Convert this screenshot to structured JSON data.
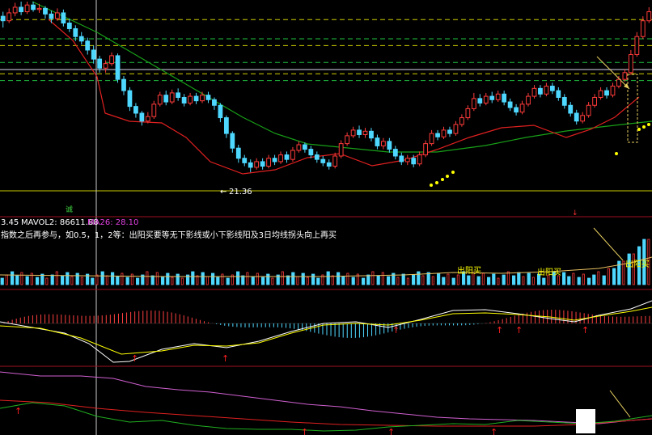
{
  "colors": {
    "up": "#ff3b3b",
    "down": "#4fd8ff",
    "ma_fast": "#e02020",
    "ma_slow": "#18a018",
    "yellow": "#ffff00",
    "white": "#ffffff",
    "magenta": "#e040e0",
    "frame": "#a01020"
  },
  "labels": {
    "low_price": "21.36",
    "vol_prefix": "3.45",
    "mavol2": "MAVOL2: 86611.88",
    "ma26": "MA26: 28.10",
    "note": "指数之后再参与，如0.5，1，2等：出阳买要等无下影线或小下影线阳及3日均线拐头向上再买",
    "buy_1": "出阳买",
    "buy_2": "出阳买",
    "buy_3": "出阳买",
    "marker_cheng": "诚"
  },
  "chart_data": {
    "type": "candlestick",
    "price": {
      "ylim": [
        20,
        36.5
      ],
      "levels": [
        34.9,
        33.2,
        32.6,
        31.1,
        30.1,
        29.5
      ],
      "candles": [
        [
          35.2,
          34.8,
          35.6,
          34.2
        ],
        [
          34.8,
          35.5,
          35.9,
          34.6
        ],
        [
          35.5,
          36.0,
          36.4,
          35.2
        ],
        [
          36.0,
          35.6,
          36.5,
          35.3
        ],
        [
          35.6,
          36.2,
          36.5,
          35.4
        ],
        [
          36.2,
          35.8,
          36.5,
          35.6
        ],
        [
          35.8,
          35.9,
          36.3,
          35.5
        ],
        [
          35.9,
          35.4,
          36.1,
          35.0
        ],
        [
          35.4,
          35.0,
          35.7,
          34.6
        ],
        [
          35.0,
          35.5,
          35.9,
          34.8
        ],
        [
          35.5,
          34.6,
          35.8,
          34.3
        ],
        [
          34.6,
          34.1,
          35.0,
          33.8
        ],
        [
          34.1,
          33.4,
          34.4,
          33.0
        ],
        [
          33.4,
          33.0,
          33.8,
          32.7
        ],
        [
          33.0,
          32.2,
          33.3,
          31.8
        ],
        [
          32.2,
          31.4,
          32.6,
          31.0
        ],
        [
          31.4,
          30.6,
          31.7,
          30.2
        ],
        [
          30.6,
          31.0,
          31.3,
          30.2
        ],
        [
          31.0,
          31.7,
          32.0,
          30.8
        ],
        [
          31.7,
          29.6,
          31.9,
          29.3
        ],
        [
          29.6,
          28.6,
          29.9,
          28.2
        ],
        [
          28.6,
          27.2,
          28.9,
          26.8
        ],
        [
          27.2,
          26.6,
          27.5,
          26.2
        ],
        [
          26.6,
          25.9,
          26.8,
          25.5
        ],
        [
          25.9,
          26.3,
          26.7,
          25.7
        ],
        [
          26.3,
          27.4,
          27.7,
          26.1
        ],
        [
          27.4,
          28.2,
          28.5,
          27.2
        ],
        [
          28.2,
          27.6,
          28.6,
          27.3
        ],
        [
          27.6,
          28.4,
          28.7,
          27.4
        ],
        [
          28.4,
          28.0,
          28.8,
          27.7
        ],
        [
          28.0,
          27.5,
          28.3,
          27.2
        ],
        [
          27.5,
          28.1,
          28.4,
          27.3
        ],
        [
          28.1,
          27.7,
          28.4,
          27.4
        ],
        [
          27.7,
          28.2,
          28.5,
          27.5
        ],
        [
          28.2,
          27.8,
          28.5,
          27.5
        ],
        [
          27.8,
          27.3,
          28.0,
          26.9
        ],
        [
          27.3,
          26.2,
          27.5,
          25.8
        ],
        [
          26.2,
          24.8,
          26.4,
          24.4
        ],
        [
          24.8,
          23.5,
          25.0,
          23.1
        ],
        [
          23.5,
          22.6,
          23.8,
          22.2
        ],
        [
          22.6,
          22.2,
          22.9,
          21.9
        ],
        [
          22.2,
          21.8,
          22.5,
          21.36
        ],
        [
          21.8,
          22.3,
          22.6,
          21.6
        ],
        [
          22.3,
          21.9,
          22.6,
          21.6
        ],
        [
          21.9,
          22.6,
          22.9,
          21.7
        ],
        [
          22.6,
          22.3,
          22.9,
          22.0
        ],
        [
          22.3,
          22.9,
          23.2,
          22.1
        ],
        [
          22.9,
          22.5,
          23.2,
          22.2
        ],
        [
          22.5,
          23.3,
          23.6,
          22.3
        ],
        [
          23.3,
          23.8,
          24.1,
          23.1
        ],
        [
          23.8,
          23.4,
          24.0,
          23.1
        ],
        [
          23.4,
          22.9,
          23.7,
          22.6
        ],
        [
          22.9,
          22.5,
          23.2,
          22.2
        ],
        [
          22.5,
          22.2,
          22.8,
          21.9
        ],
        [
          22.2,
          21.9,
          22.5,
          21.6
        ],
        [
          21.9,
          22.8,
          23.1,
          21.7
        ],
        [
          22.8,
          23.9,
          24.2,
          22.6
        ],
        [
          23.9,
          24.6,
          24.9,
          23.7
        ],
        [
          24.6,
          25.1,
          25.4,
          24.4
        ],
        [
          25.1,
          24.7,
          25.5,
          24.4
        ],
        [
          24.7,
          25.0,
          25.3,
          24.4
        ],
        [
          25.0,
          24.4,
          25.3,
          24.1
        ],
        [
          24.4,
          23.7,
          24.7,
          23.4
        ],
        [
          23.7,
          24.1,
          24.4,
          23.4
        ],
        [
          24.1,
          23.4,
          24.4,
          23.1
        ],
        [
          23.4,
          22.8,
          23.7,
          22.5
        ],
        [
          22.8,
          22.3,
          23.1,
          22.0
        ],
        [
          22.3,
          22.6,
          22.9,
          22.0
        ],
        [
          22.6,
          22.1,
          22.9,
          21.8
        ],
        [
          22.1,
          22.9,
          23.2,
          21.9
        ],
        [
          22.9,
          23.9,
          24.2,
          22.7
        ],
        [
          23.9,
          24.8,
          25.1,
          23.7
        ],
        [
          24.8,
          24.5,
          25.1,
          24.2
        ],
        [
          24.5,
          25.1,
          25.4,
          24.3
        ],
        [
          25.1,
          24.8,
          25.4,
          24.5
        ],
        [
          24.8,
          25.6,
          25.9,
          24.6
        ],
        [
          25.6,
          26.2,
          26.5,
          25.4
        ],
        [
          26.2,
          27.0,
          27.3,
          26.0
        ],
        [
          27.0,
          27.9,
          28.4,
          26.8
        ],
        [
          27.9,
          27.5,
          28.3,
          27.2
        ],
        [
          27.5,
          28.1,
          28.4,
          27.3
        ],
        [
          28.1,
          27.8,
          28.5,
          27.5
        ],
        [
          27.8,
          28.3,
          28.6,
          27.6
        ],
        [
          28.3,
          27.6,
          28.6,
          27.3
        ],
        [
          27.6,
          27.1,
          27.9,
          26.8
        ],
        [
          27.1,
          26.7,
          27.4,
          26.4
        ],
        [
          26.7,
          27.4,
          27.7,
          26.5
        ],
        [
          27.4,
          28.1,
          28.4,
          27.2
        ],
        [
          28.1,
          28.8,
          29.1,
          27.9
        ],
        [
          28.8,
          28.3,
          29.1,
          28.0
        ],
        [
          28.3,
          29.0,
          29.3,
          28.1
        ],
        [
          29.0,
          28.6,
          29.3,
          28.3
        ],
        [
          28.6,
          28.0,
          28.9,
          27.7
        ],
        [
          28.0,
          27.3,
          28.3,
          27.0
        ],
        [
          27.3,
          26.6,
          27.6,
          26.3
        ],
        [
          26.6,
          25.9,
          26.9,
          25.6
        ],
        [
          25.9,
          26.4,
          26.7,
          25.7
        ],
        [
          26.4,
          27.3,
          27.6,
          26.2
        ],
        [
          27.3,
          28.0,
          28.3,
          27.1
        ],
        [
          28.0,
          28.6,
          28.9,
          27.8
        ],
        [
          28.6,
          28.2,
          28.9,
          27.9
        ],
        [
          28.2,
          29.0,
          29.3,
          28.0
        ],
        [
          29.0,
          29.6,
          29.9,
          28.8
        ],
        [
          29.6,
          30.2,
          30.5,
          29.4
        ],
        [
          30.2,
          31.8,
          32.2,
          30.0
        ],
        [
          31.8,
          33.4,
          33.8,
          31.6
        ],
        [
          33.4,
          34.8,
          35.2,
          33.2
        ],
        [
          34.8,
          35.6,
          36.0,
          34.6
        ]
      ]
    },
    "ma_fast_pts": [
      [
        60,
        24
      ],
      [
        90,
        50
      ],
      [
        120,
        95
      ],
      [
        130,
        140
      ],
      [
        160,
        150
      ],
      [
        200,
        152
      ],
      [
        230,
        170
      ],
      [
        260,
        200
      ],
      [
        300,
        215
      ],
      [
        340,
        210
      ],
      [
        380,
        195
      ],
      [
        420,
        190
      ],
      [
        460,
        205
      ],
      [
        500,
        198
      ],
      [
        540,
        185
      ],
      [
        580,
        170
      ],
      [
        620,
        158
      ],
      [
        660,
        155
      ],
      [
        700,
        170
      ],
      [
        730,
        160
      ],
      [
        760,
        145
      ],
      [
        790,
        120
      ]
    ],
    "ma_slow_pts": [
      [
        40,
        2
      ],
      [
        120,
        40
      ],
      [
        180,
        75
      ],
      [
        240,
        110
      ],
      [
        300,
        145
      ],
      [
        340,
        165
      ],
      [
        380,
        178
      ],
      [
        430,
        183
      ],
      [
        480,
        188
      ],
      [
        540,
        188
      ],
      [
        600,
        180
      ],
      [
        650,
        170
      ],
      [
        700,
        162
      ],
      [
        760,
        155
      ],
      [
        806,
        150
      ]
    ],
    "dots": [
      [
        533,
        229
      ],
      [
        540,
        226
      ],
      [
        547,
        222
      ],
      [
        553,
        218
      ],
      [
        560,
        213
      ],
      [
        762,
        190
      ],
      [
        790,
        160
      ],
      [
        796,
        157
      ],
      [
        802,
        154
      ]
    ]
  }
}
